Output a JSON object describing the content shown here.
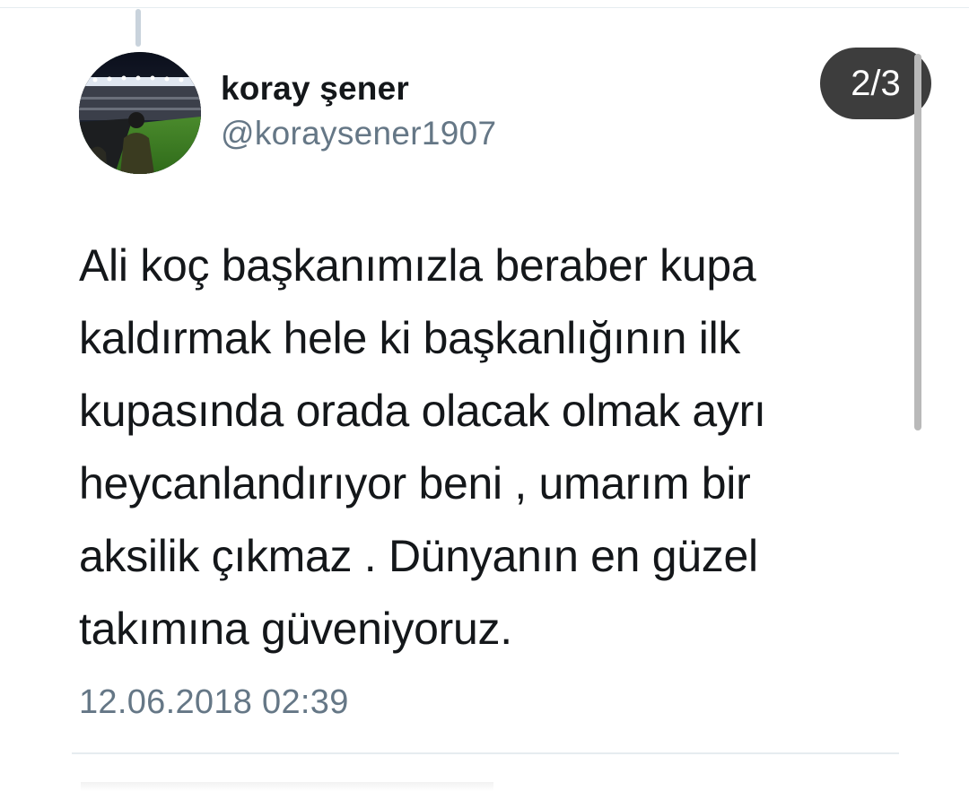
{
  "tweet": {
    "author": {
      "display_name": "koray şener",
      "handle": "@koraysener1907",
      "avatar_icon": "stadium-photo-avatar"
    },
    "thread_position": "2/3",
    "text_lines": [
      "Ali koç başkanımızla beraber kupa",
      "kaldırmak hele ki başkanlığının ilk",
      "kupasında orada olacak olmak ayrı",
      "heycanlandırıyor beni , umarım bir",
      "aksilik çıkmaz . Dünyanın en güzel",
      "takımına güveniyoruz."
    ],
    "timestamp": "12.06.2018 02:39"
  },
  "colors": {
    "primary_text": "#14171a",
    "secondary_text": "#657786",
    "badge_bg": "#3d3d3d",
    "divider": "#e6ecf0"
  }
}
